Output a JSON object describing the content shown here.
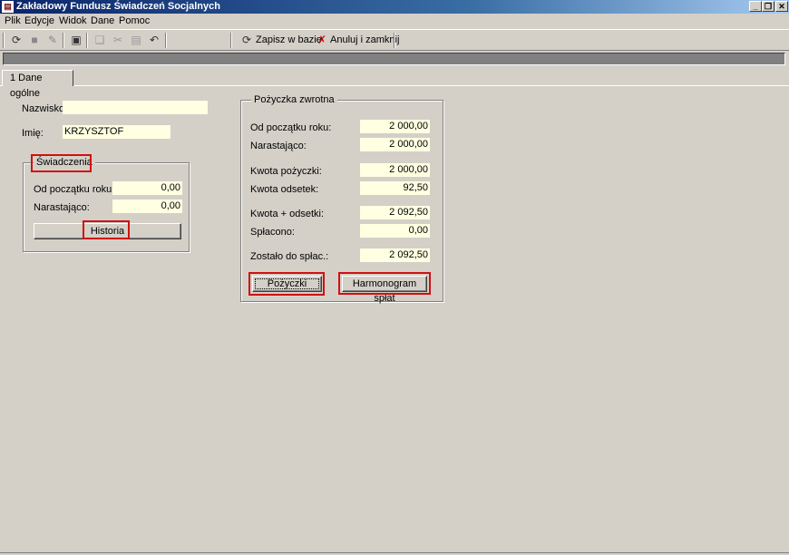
{
  "window": {
    "title": "Zakładowy Fundusz Świadczeń Socjalnych",
    "app_icon": "app-icon",
    "controls": [
      "minimize-icon",
      "restore-icon",
      "close-icon"
    ]
  },
  "menu": [
    "Plik",
    "Edycje",
    "Widok",
    "Dane",
    "Pomoc"
  ],
  "toolbar": {
    "icons": [
      "refresh-icon",
      "save-disk-icon",
      "tools-icon",
      "properties-icon",
      "copy-icon",
      "cut-icon",
      "paste-icon",
      "undo-icon"
    ],
    "save_label": "Zapisz w bazie",
    "cancel_label": "Anuluj i zamknij"
  },
  "tabs": [
    {
      "label": "1 Dane ogólne",
      "active": true
    }
  ],
  "person": {
    "surname_label": "Nazwisko:",
    "surname_value": "",
    "name_label": "Imię:",
    "name_value": "KRZYSZTOF"
  },
  "benefits": {
    "title": "Świadczenia",
    "from_year_label": "Od początku roku:",
    "from_year_value": "0,00",
    "cumulative_label": "Narastająco:",
    "cumulative_value": "0,00",
    "history_button": "Historia"
  },
  "loan": {
    "title": "Pożyczka zwrotna",
    "from_year_label": "Od początku roku:",
    "from_year_value": "2 000,00",
    "cumulative_label": "Narastająco:",
    "cumulative_value": "2 000,00",
    "amount_label": "Kwota pożyczki:",
    "amount_value": "2 000,00",
    "interest_label": "Kwota odsetek:",
    "interest_value": "92,50",
    "total_label": "Kwota + odsetki:",
    "total_value": "2 092,50",
    "repaid_label": "Spłacono:",
    "repaid_value": "0,00",
    "remaining_label": "Zostało do spłac.:",
    "remaining_value": "2 092,50",
    "loans_button": "Pożyczki",
    "schedule_button": "Harmonogram spłat"
  },
  "colors": {
    "field_bg": "#ffffe1",
    "highlight": "#d01010",
    "window_bg": "#d4d0c8"
  }
}
